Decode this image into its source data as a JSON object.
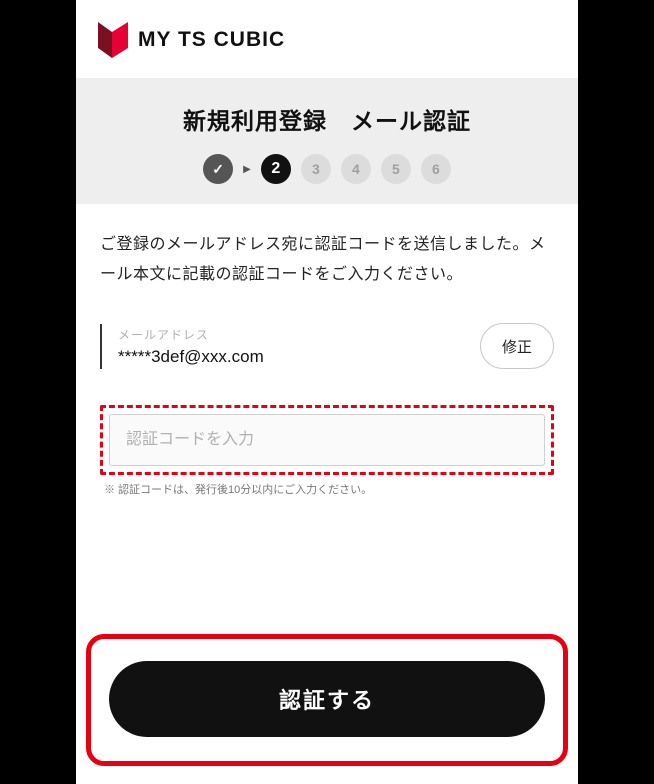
{
  "brand": "MY TS CUBIC",
  "page_title": "新規利用登録　メール認証",
  "steps": {
    "current": 2,
    "labels": [
      "",
      "2",
      "3",
      "4",
      "5",
      "6"
    ]
  },
  "instruction": "ご登録のメールアドレス宛に認証コードを送信しました。メール本文に記載の認証コードをご入力ください。",
  "email": {
    "label": "メールアドレス",
    "value": "*****3def@xxx.com",
    "edit_label": "修正"
  },
  "code": {
    "placeholder": "認証コードを入力",
    "note": "※ 認証コードは、発行後10分以内にご入力ください。"
  },
  "action": {
    "submit_label": "認証する"
  }
}
